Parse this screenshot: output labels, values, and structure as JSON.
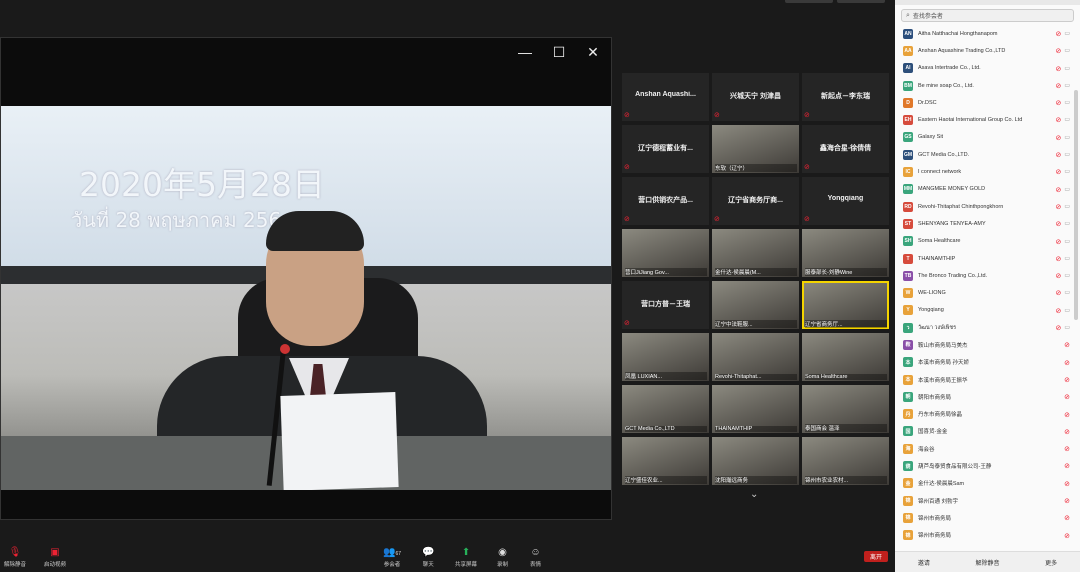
{
  "main_video": {
    "date_cn": "2020年5月28日",
    "date_th": "วันที่ 28 พฤษภาคม 256"
  },
  "tiles": [
    {
      "name": "Anshan Aquashi...",
      "cap": ""
    },
    {
      "name": "兴城天宁 刘津昌",
      "cap": ""
    },
    {
      "name": "新起点－李东瑞",
      "cap": ""
    },
    {
      "name": "辽宁德程蓄业有...",
      "cap": ""
    },
    {
      "name": "",
      "cap": "东软（辽宁）"
    },
    {
      "name": "鑫海合星-徐倩倩",
      "cap": ""
    },
    {
      "name": "营口供销农产品...",
      "cap": ""
    },
    {
      "name": "辽宁省商务厅商...",
      "cap": ""
    },
    {
      "name": "Yongqiang",
      "cap": ""
    },
    {
      "name": "",
      "cap": "营口JiJiang Gov..."
    },
    {
      "name": "",
      "cap": "金什达-侯晨晨(M..."
    },
    {
      "name": "",
      "cap": "服泰部长-刘静Wine"
    },
    {
      "name": "营口方普－王瑞",
      "cap": ""
    },
    {
      "name": "",
      "cap": "辽宁中法鞋服..."
    },
    {
      "name": "",
      "cap": "辽宁省商务厅..."
    },
    {
      "name": "",
      "cap": "凤凰 LUXIAN..."
    },
    {
      "name": "",
      "cap": "Revohi-Thitaphat..."
    },
    {
      "name": "",
      "cap": "Soma Healthcare"
    },
    {
      "name": "",
      "cap": "GCT Media Co.,LTD"
    },
    {
      "name": "",
      "cap": "THAINAMTHIP"
    },
    {
      "name": "",
      "cap": "泰国商会 温泽"
    },
    {
      "name": "",
      "cap": "辽宁盛佳农业..."
    },
    {
      "name": "",
      "cap": "沈阳瀚远商务"
    },
    {
      "name": "",
      "cap": "锦州市农业农村..."
    }
  ],
  "panel": {
    "search_placeholder": "查找参会者",
    "participants": [
      {
        "initials": "AN",
        "name": "Aitha Natthachai Hongthanapom",
        "color": "#2b4e7c"
      },
      {
        "initials": "AA",
        "name": "Anshan Aquashine Trading Co.,LTD",
        "color": "#e8a23a"
      },
      {
        "initials": "AI",
        "name": "Asava Intertrade Co., Ltd.",
        "color": "#2d4f7a"
      },
      {
        "initials": "BM",
        "name": "Be mine soap Co., Ltd.",
        "color": "#3aa57c"
      },
      {
        "initials": "D",
        "name": "Dr.DSC",
        "color": "#e0782a"
      },
      {
        "initials": "EH",
        "name": "Eastern Haotai International Group Co. Ltd",
        "color": "#d64b3c"
      },
      {
        "initials": "GS",
        "name": "Galaxy Sit",
        "color": "#3aa57c"
      },
      {
        "initials": "GM",
        "name": "GCT Media Co.,LTD.",
        "color": "#2d4f7a"
      },
      {
        "initials": "IC",
        "name": "I connect network",
        "color": "#e8a23a"
      },
      {
        "initials": "MM",
        "name": "MANGMEE MONEY GOLD",
        "color": "#3aa57c"
      },
      {
        "initials": "RD",
        "name": "Revohi-Thitaphat Chinthpongkhorn",
        "color": "#d64b3c"
      },
      {
        "initials": "ST",
        "name": "SHENYANG TENYEA-AMY",
        "color": "#d64b3c"
      },
      {
        "initials": "SH",
        "name": "Soma Healthcare",
        "color": "#3aa57c"
      },
      {
        "initials": "T",
        "name": "THAINAMTHIP",
        "color": "#d64b3c"
      },
      {
        "initials": "TB",
        "name": "The Bronco Trading Co.,Ltd.",
        "color": "#8a4fa8"
      },
      {
        "initials": "W",
        "name": "WE-LIONG",
        "color": "#e8a23a"
      },
      {
        "initials": "Y",
        "name": "Yongqiang",
        "color": "#e8a23a"
      },
      {
        "initials": "ว",
        "name": "วัฒนา วงษ์เพ็ชร",
        "color": "#3aa57c"
      },
      {
        "initials": "鞍",
        "name": "鞍山市商务局马美杰",
        "color": "#8a4fa8"
      },
      {
        "initials": "本",
        "name": "本溪市商务局 孙天娇",
        "color": "#3aa57c"
      },
      {
        "initials": "本",
        "name": "本溪市商务局王振华",
        "color": "#e8a23a"
      },
      {
        "initials": "朝",
        "name": "朝阳市商务局",
        "color": "#3aa57c"
      },
      {
        "initials": "丹",
        "name": "丹东市商务局徐晶",
        "color": "#e8a23a"
      },
      {
        "initials": "国",
        "name": "国喜货-金金",
        "color": "#3aa57c"
      },
      {
        "initials": "海",
        "name": "海会谷",
        "color": "#e8a23a"
      },
      {
        "initials": "葫",
        "name": "葫芦岛泰贸食品有限公司-王静",
        "color": "#3aa57c"
      },
      {
        "initials": "金",
        "name": "金什达-侯晨晨Sam",
        "color": "#e8a23a"
      },
      {
        "initials": "锦",
        "name": "锦州百通 刘勃宇",
        "color": "#e8a23a"
      },
      {
        "initials": "锦",
        "name": "锦州市商务局",
        "color": "#e8a23a"
      },
      {
        "initials": "锦",
        "name": "锦州市商务局",
        "color": "#e8a23a"
      }
    ],
    "footer": {
      "invite": "邀请",
      "unmute_all": "解除静音",
      "more": "更多"
    }
  },
  "toolbar": {
    "unmute": "解除静音",
    "start_video": "启动视频",
    "participants": "参会者",
    "participants_count": "67",
    "chat": "聊天",
    "share": "共享屏幕",
    "record": "录制",
    "reactions": "表情",
    "end": "离开"
  },
  "colors": {
    "accent": "#f4d400",
    "danger": "#c0201d",
    "share_green": "#27b15a"
  }
}
